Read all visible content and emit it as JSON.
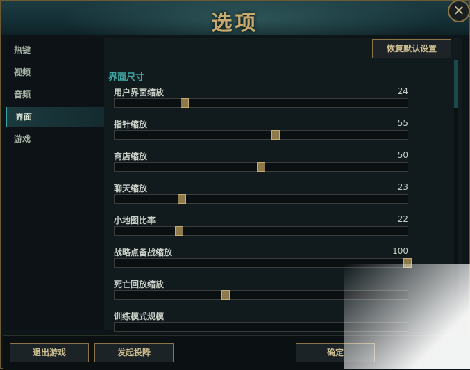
{
  "window": {
    "title": "选项",
    "close_glyph": "✕"
  },
  "sidebar": {
    "items": [
      {
        "label": "热键",
        "active": false
      },
      {
        "label": "视频",
        "active": false
      },
      {
        "label": "音频",
        "active": false
      },
      {
        "label": "界面",
        "active": true
      },
      {
        "label": "游戏",
        "active": false
      }
    ]
  },
  "content": {
    "reset_label": "恢复默认设置",
    "section_title": "界面尺寸",
    "sliders": [
      {
        "label": "用户界面缩放",
        "value": "24",
        "level": 24
      },
      {
        "label": "指针缩放",
        "value": "55",
        "level": 55
      },
      {
        "label": "商店缩放",
        "value": "50",
        "level": 50
      },
      {
        "label": "聊天缩放",
        "value": "23",
        "level": 23
      },
      {
        "label": "小地图比率",
        "value": "22",
        "level": 22
      },
      {
        "label": "战略点备战缩放",
        "value": "100",
        "level": 100
      },
      {
        "label": "死亡回放缩放",
        "value": "",
        "level": 38
      },
      {
        "label": "训练模式规模",
        "value": "",
        "level": null
      }
    ]
  },
  "footer": {
    "exit_label": "退出游戏",
    "surrender_label": "发起投降",
    "confirm_label": "确定"
  },
  "colors": {
    "accent_gold": "#c8aa6e",
    "accent_teal": "#3fa6a4",
    "background": "#0e1518"
  }
}
